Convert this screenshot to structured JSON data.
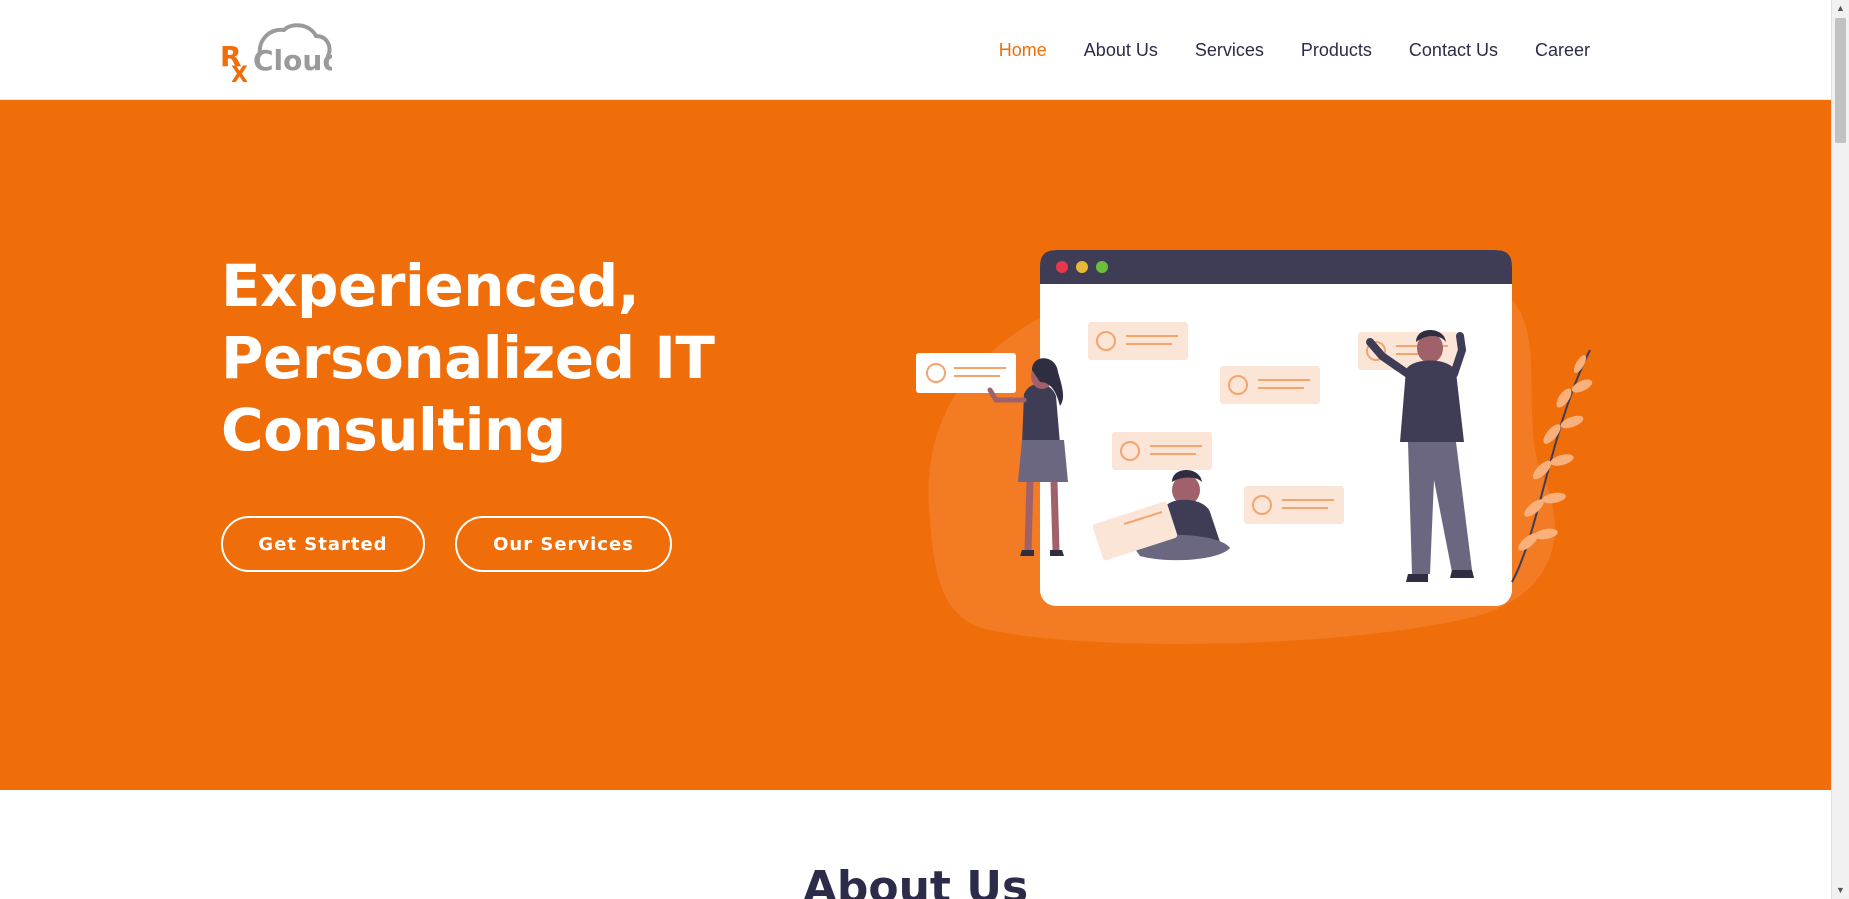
{
  "header": {
    "logo": {
      "prefix": "R",
      "subscript": "X",
      "name": "Cloud"
    },
    "nav": [
      {
        "label": "Home",
        "active": true
      },
      {
        "label": "About Us",
        "active": false
      },
      {
        "label": "Services",
        "active": false
      },
      {
        "label": "Products",
        "active": false
      },
      {
        "label": "Contact Us",
        "active": false
      },
      {
        "label": "Career",
        "active": false
      }
    ]
  },
  "hero": {
    "title_lines": [
      "Experienced,",
      "Personalized IT",
      "Consulting"
    ],
    "primary_button": "Get Started",
    "secondary_button": "Our Services",
    "background_color": "#f06e0a"
  },
  "about": {
    "title": "About Us"
  },
  "colors": {
    "accent": "#f06e0a",
    "text_dark": "#2c2c4a",
    "illustration_dark": "#3f3d56"
  }
}
